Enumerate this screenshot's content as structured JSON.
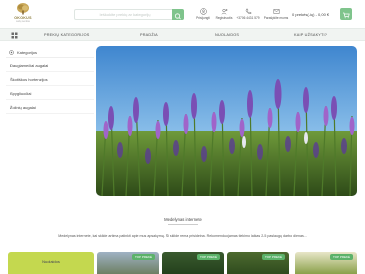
{
  "header": {
    "logo_text": "OKOKUS",
    "logo_sub": "sodų centras",
    "search_placeholder": "Ieškokite prekių ar kategorijų",
    "links": [
      {
        "label": "Prisijungti"
      },
      {
        "label": "Registruotis"
      },
      {
        "label": "+3706 4431 579"
      },
      {
        "label": "Parašykite mums"
      }
    ],
    "cart_text": "0 prekės(-ių) - 0,00 €"
  },
  "nav": {
    "items": [
      "PREKIŲ KATEGORIJOS",
      "PRADŽIA",
      "NUOLAIDOS",
      "KAIP UŽSAKYTI?"
    ]
  },
  "sidebar": {
    "heading": "Kategorijos",
    "items": [
      {
        "label": "Daugiamečiai augalai",
        "has_children": true
      },
      {
        "label": "Škotiškos hortenzijos",
        "has_children": false
      },
      {
        "label": "Spygliuočiai",
        "has_children": true
      },
      {
        "label": "Žolinių augalai",
        "has_children": true
      }
    ]
  },
  "content": {
    "section_title": "Medelynas internete",
    "info_line": "Medelynas internete, kai sklide artima patinkti apie mus apsakymą. Ši sklide rema prisideina. Rekomenduojamas tiekimo laikas 2-5 paslaugų darbo dienas..."
  },
  "cards": {
    "sale_label": "Nuolaidos",
    "badges": [
      "TOP PREKĖ",
      "TOP PREKĖ",
      "TOP PREKĖ",
      "TOP PREKĖ"
    ]
  },
  "colors": {
    "accent": "#7fc48c",
    "nav_bg": "#f1f4f2",
    "sale_bg": "#c4d84f",
    "badge": "#5cb26a"
  }
}
